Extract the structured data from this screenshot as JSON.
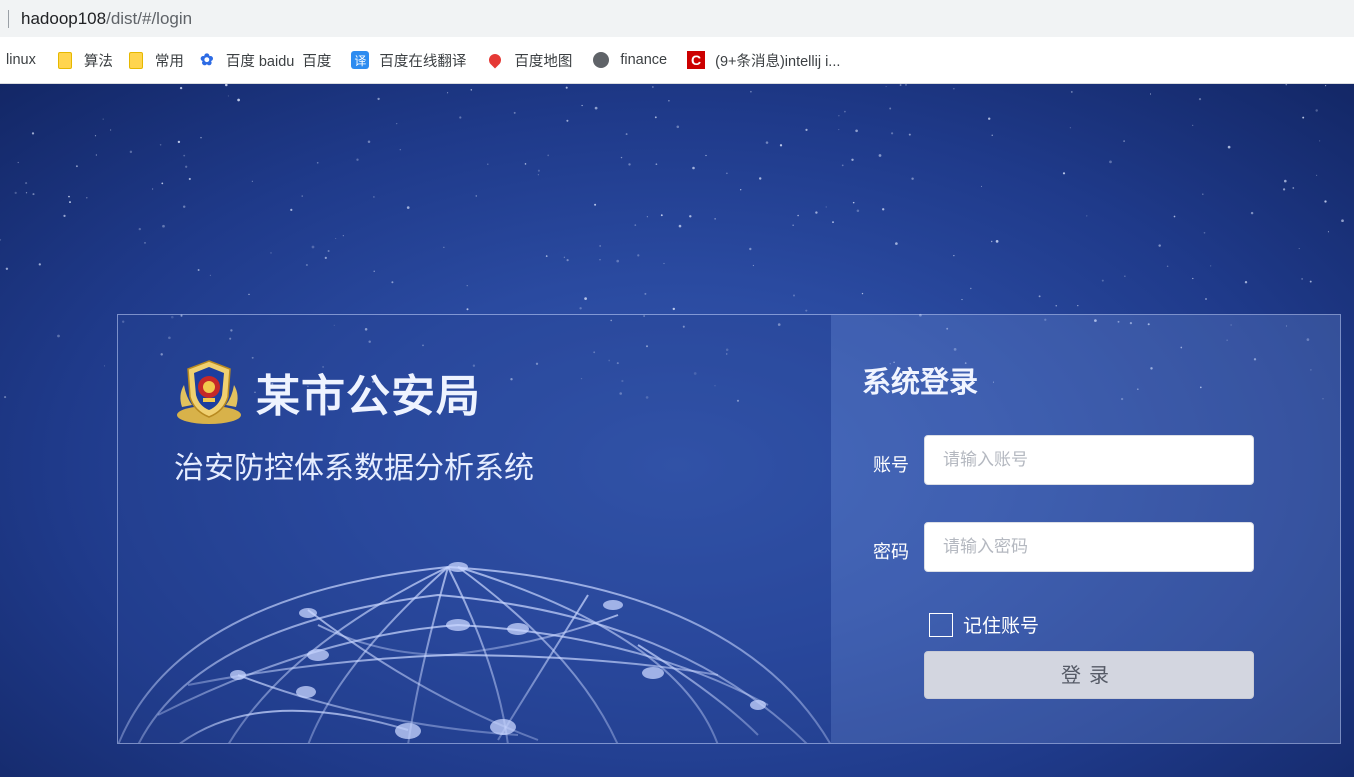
{
  "browser": {
    "url_host": "hadoop108",
    "url_path": "/dist/#/login",
    "bookmarks": [
      {
        "label": "linux",
        "icon": "none"
      },
      {
        "label": "算法",
        "icon": "folder-icon"
      },
      {
        "label": "常用",
        "icon": "folder-icon"
      },
      {
        "label": "百度 baidu",
        "icon": "baidu-icon"
      },
      {
        "label": "百度",
        "icon": "none"
      },
      {
        "label": "百度在线翻译",
        "icon": "translate-icon"
      },
      {
        "label": "百度地图",
        "icon": "map-pin-icon"
      },
      {
        "label": "finance",
        "icon": "globe-icon"
      },
      {
        "label": "(9+条消息)intellij i...",
        "icon": "csdn-icon"
      }
    ],
    "translate_glyph": "译",
    "csdn_glyph": "C"
  },
  "brand": {
    "title": "某市公安局",
    "subtitle": "治安防控体系数据分析系统"
  },
  "login": {
    "title": "系统登录",
    "account_label": "账号",
    "account_placeholder": "请输入账号",
    "password_label": "密码",
    "password_placeholder": "请输入密码",
    "remember_label": "记住账号",
    "remember_checked": false,
    "submit_label": "登录"
  },
  "colors": {
    "background": "#1f3a8a",
    "panel_border": "#c8d7ff",
    "button_bg": "#d3d6e0"
  }
}
